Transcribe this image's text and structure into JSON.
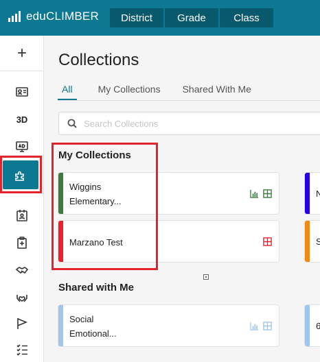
{
  "app": {
    "title": "eduCLIMBER",
    "nav": [
      "District",
      "Grade",
      "Class"
    ]
  },
  "sidebar": {
    "plus": "+",
    "items": [
      {
        "icon": "id-card-icon"
      },
      {
        "icon": "3d-text-icon",
        "label": "3D"
      },
      {
        "icon": "ad-screen-icon"
      },
      {
        "icon": "puzzle-icon",
        "active": true
      },
      {
        "icon": "calendar-person-icon"
      },
      {
        "icon": "clipboard-plus-icon"
      },
      {
        "icon": "handshake-icon"
      },
      {
        "icon": "heart-hands-icon"
      },
      {
        "icon": "flag-icon"
      },
      {
        "icon": "checklist-icon"
      }
    ]
  },
  "page": {
    "title": "Collections",
    "tabs": [
      "All",
      "My Collections",
      "Shared With Me"
    ],
    "active_tab": "All",
    "search_placeholder": "Search Collections"
  },
  "sections": {
    "my": {
      "title": "My Collections",
      "cards": [
        {
          "line1": "Wiggins",
          "line2": "Elementary...",
          "stripe": "#3a7d3e",
          "icons": [
            "bar-chart-icon",
            "grid-icon"
          ],
          "icon_color": "#3a7d3e"
        },
        {
          "line1": "Marzano Test",
          "line2": "",
          "stripe": "#f01d2c",
          "icons": [
            "grid-icon"
          ],
          "icon_color": "#e3232c"
        }
      ],
      "edge_cards": [
        {
          "letter": "N",
          "stripe": "#2300e8"
        },
        {
          "letter": "S",
          "stripe": "#f08a12"
        }
      ]
    },
    "shared": {
      "title": "Shared with Me",
      "cards": [
        {
          "line1": "Social",
          "line2": "Emotional...",
          "stripe": "#9ec6ef",
          "icons": [
            "bar-chart-icon",
            "grid-icon"
          ],
          "icon_color": "#9ec6ef"
        }
      ],
      "edge_cards": [
        {
          "letter": "6",
          "stripe": "#9ec6ef"
        }
      ]
    }
  },
  "colors": {
    "brand": "#0d7891",
    "brand_dark": "#09596c",
    "highlight": "#e3232c"
  }
}
